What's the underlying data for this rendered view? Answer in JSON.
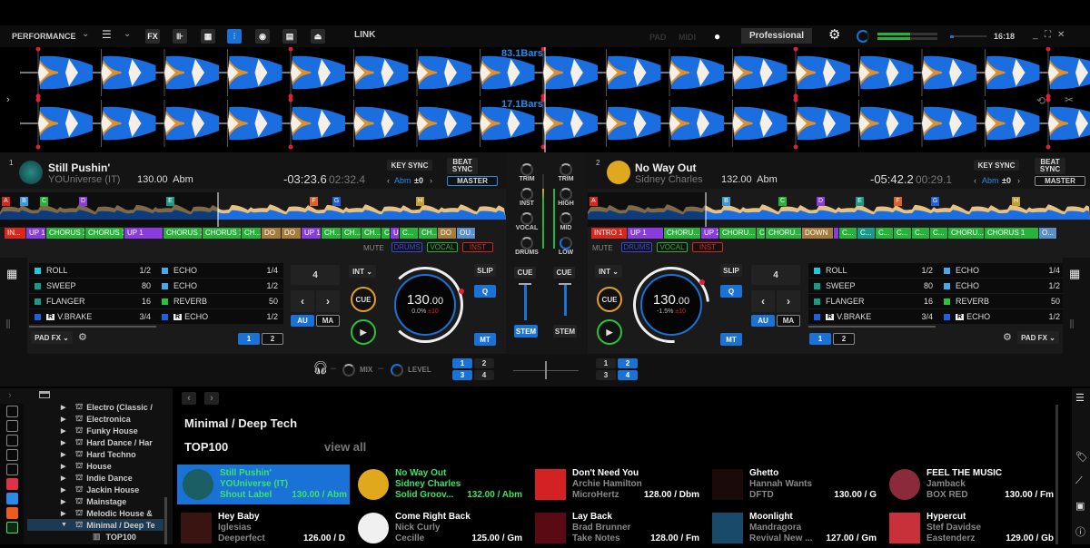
{
  "topbar": {
    "layout_label": "PERFORMANCE",
    "icons": [
      "fx-icon",
      "sampler-icon",
      "grid-icon",
      "mixer-icon",
      "record-icon",
      "video-icon",
      "webcam-icon"
    ],
    "link_label": "LINK",
    "pad_label": "PAD",
    "midi_label": "MIDI",
    "mode_label": "Professional",
    "time": "16:18"
  },
  "waveform": {
    "deck1_bars": "83.1Bars",
    "deck2_bars": "17.1Bars"
  },
  "deck1": {
    "number": "1",
    "title": "Still Pushin'",
    "artist": "YOUniverse (IT)",
    "bpm_key": "130.00  Abm",
    "remaining": "-03:23.6",
    "elapsed": "02:32.4",
    "key_sync": "KEY SYNC",
    "beat_sync": "BEAT SYNC",
    "key": "Abm",
    "key_offset": "±0",
    "master": "MASTER",
    "hotcues": [
      "A",
      "B",
      "C",
      "D",
      "E",
      "F",
      "G",
      "H"
    ],
    "segments": [
      {
        "label": "IN...",
        "color": "#d8281e",
        "w": 24
      },
      {
        "label": "UP 1",
        "color": "#8a3ce0",
        "w": 22
      },
      {
        "label": "CHORUS 1",
        "color": "#27b33a",
        "w": 43
      },
      {
        "label": "CHORUS 1",
        "color": "#27b33a",
        "w": 43
      },
      {
        "label": "UP 1",
        "color": "#8a3ce0",
        "w": 43
      },
      {
        "label": "CHORUS 1",
        "color": "#27b33a",
        "w": 43
      },
      {
        "label": "CHORUS 1",
        "color": "#27b33a",
        "w": 43
      },
      {
        "label": "CH...",
        "color": "#27b33a",
        "w": 22
      },
      {
        "label": "DO",
        "color": "#a67c3c",
        "w": 22
      },
      {
        "label": "DO",
        "color": "#a67c3c",
        "w": 22
      },
      {
        "label": "UP 1",
        "color": "#8a3ce0",
        "w": 22
      },
      {
        "label": "CH...",
        "color": "#27b33a",
        "w": 22
      },
      {
        "label": "CH...",
        "color": "#27b33a",
        "w": 22
      },
      {
        "label": "CH...",
        "color": "#27b33a",
        "w": 22
      },
      {
        "label": "C",
        "color": "#27b33a",
        "w": 10
      },
      {
        "label": "U",
        "color": "#8a3ce0",
        "w": 10
      },
      {
        "label": "C...",
        "color": "#27b33a",
        "w": 21
      },
      {
        "label": "CH...",
        "color": "#27b33a",
        "w": 21
      },
      {
        "label": "DO",
        "color": "#a67c3c",
        "w": 21
      },
      {
        "label": "OU...",
        "color": "#5b8fc9",
        "w": 21
      }
    ],
    "mute_label": "MUTE",
    "stems": [
      "DRUMS",
      "VOCAL",
      "INST"
    ],
    "pad_fx": [
      {
        "name": "ROLL",
        "val": "1/2",
        "color": "#1fc7e0",
        "r": false
      },
      {
        "name": "SWEEP",
        "val": "80",
        "color": "#1a9b8a",
        "r": false
      },
      {
        "name": "FLANGER",
        "val": "16",
        "color": "#1a9b8a",
        "r": false
      },
      {
        "name": "V.BRAKE",
        "val": "3/4",
        "color": "#2060e0",
        "r": true
      }
    ],
    "pad_fx2": [
      {
        "name": "ECHO",
        "val": "1/4",
        "color": "#4aa8e8",
        "r": false
      },
      {
        "name": "ECHO",
        "val": "1/2",
        "color": "#4aa8e8",
        "r": false
      },
      {
        "name": "REVERB",
        "val": "50",
        "color": "#28c43a",
        "r": false
      },
      {
        "name": "ECHO",
        "val": "1/2",
        "color": "#2060e0",
        "r": true
      }
    ],
    "pad_fx_label": "PAD FX",
    "pages": [
      "1",
      "2"
    ],
    "loop_beats": "4",
    "au": "AU",
    "ma": "MA",
    "int": "INT",
    "cue": "CUE",
    "jog_bpm": "130",
    "jog_bpm_dec": ".00",
    "pitch": "0.0%",
    "range": "±10",
    "slip": "SLIP",
    "q": "Q",
    "mt": "MT"
  },
  "deck2": {
    "number": "2",
    "title": "No Way Out",
    "artist": "Sidney Charles",
    "bpm_key": "132.00  Abm",
    "remaining": "-05:42.2",
    "elapsed": "00:29.1",
    "key_sync": "KEY SYNC",
    "beat_sync": "BEAT SYNC",
    "key": "Abm",
    "key_offset": "±0",
    "master": "MASTER",
    "hotcues": [
      "A",
      "B",
      "C",
      "D",
      "E",
      "F",
      "G",
      "H"
    ],
    "segments": [
      {
        "label": "INTRO 1",
        "color": "#d8281e",
        "w": 40
      },
      {
        "label": "UP 1",
        "color": "#8a3ce0",
        "w": 40
      },
      {
        "label": "CHORU...",
        "color": "#27b33a",
        "w": 41
      },
      {
        "label": "UP 2",
        "color": "#8a3ce0",
        "w": 20
      },
      {
        "label": "CHORU...",
        "color": "#27b33a",
        "w": 41
      },
      {
        "label": "C",
        "color": "#27b33a",
        "w": 10
      },
      {
        "label": "CHORU...",
        "color": "#27b33a",
        "w": 40
      },
      {
        "label": "DOWN",
        "color": "#a67c3c",
        "w": 35
      },
      {
        "label": "",
        "color": "#8a3ce0",
        "w": 6
      },
      {
        "label": "C...",
        "color": "#27b33a",
        "w": 20
      },
      {
        "label": "C...",
        "color": "#1a9b8a",
        "w": 20
      },
      {
        "label": "C...",
        "color": "#27b33a",
        "w": 20
      },
      {
        "label": "C...",
        "color": "#27b33a",
        "w": 20
      },
      {
        "label": "C...",
        "color": "#27b33a",
        "w": 20
      },
      {
        "label": "C...",
        "color": "#27b33a",
        "w": 20
      },
      {
        "label": "CHORU...",
        "color": "#27b33a",
        "w": 40
      },
      {
        "label": "CHORUS 1",
        "color": "#27b33a",
        "w": 60
      },
      {
        "label": "O...",
        "color": "#5b8fc9",
        "w": 20
      }
    ],
    "mute_label": "MUTE",
    "stems": [
      "DRUMS",
      "VOCAL",
      "INST"
    ],
    "pad_fx": [
      {
        "name": "ROLL",
        "val": "1/2",
        "color": "#1fc7e0",
        "r": false
      },
      {
        "name": "SWEEP",
        "val": "80",
        "color": "#1a9b8a",
        "r": false
      },
      {
        "name": "FLANGER",
        "val": "16",
        "color": "#1a9b8a",
        "r": false
      },
      {
        "name": "V.BRAKE",
        "val": "3/4",
        "color": "#2060e0",
        "r": true
      }
    ],
    "pad_fx2": [
      {
        "name": "ECHO",
        "val": "1/4",
        "color": "#4aa8e8",
        "r": false
      },
      {
        "name": "ECHO",
        "val": "1/2",
        "color": "#4aa8e8",
        "r": false
      },
      {
        "name": "REVERB",
        "val": "50",
        "color": "#28c43a",
        "r": false
      },
      {
        "name": "ECHO",
        "val": "1/2",
        "color": "#2060e0",
        "r": true
      }
    ],
    "pad_fx_label": "PAD FX",
    "pages": [
      "1",
      "2"
    ],
    "loop_beats": "4",
    "au": "AU",
    "ma": "MA",
    "int": "INT",
    "cue": "CUE",
    "jog_bpm": "130",
    "jog_bpm_dec": ".00",
    "pitch": "-1.5%",
    "range": "±10",
    "slip": "SLIP",
    "q": "Q",
    "mt": "MT"
  },
  "mixer": {
    "left_knobs": [
      "TRIM",
      "INST",
      "VOCAL",
      "DRUMS"
    ],
    "right_knobs": [
      "TRIM",
      "HIGH",
      "MID",
      "LOW"
    ],
    "cue": "CUE",
    "stem": "STEM",
    "mix_label": "MIX",
    "level_label": "LEVEL",
    "deck_sel_left": [
      "1",
      "2",
      "3",
      "4"
    ],
    "deck_sel_right": [
      "1",
      "2",
      "3",
      "4"
    ]
  },
  "browser": {
    "tree": [
      {
        "label": "Electro (Classic /",
        "expanded": false
      },
      {
        "label": "Electronica",
        "expanded": false
      },
      {
        "label": "Funky House",
        "expanded": false
      },
      {
        "label": "Hard Dance / Har",
        "expanded": false
      },
      {
        "label": "Hard Techno",
        "expanded": false
      },
      {
        "label": "House",
        "expanded": false
      },
      {
        "label": "Indie Dance",
        "expanded": false
      },
      {
        "label": "Jackin House",
        "expanded": false
      },
      {
        "label": "Mainstage",
        "expanded": false
      },
      {
        "label": "Melodic House &",
        "expanded": false
      },
      {
        "label": "Minimal / Deep Te",
        "expanded": true
      }
    ],
    "tree_child": "TOP100",
    "heading": "Minimal / Deep Tech",
    "section": "TOP100",
    "view_all": "view all",
    "tracks": [
      {
        "title": "Still Pushin'",
        "artist": "YOUniverse (IT)",
        "label": "Shout Label",
        "bpm_key": "130.00 / Abm",
        "art": "#1b5e63",
        "state": "sel"
      },
      {
        "title": "No Way Out",
        "artist": "Sidney Charles",
        "label": "Solid Groov...",
        "bpm_key": "132.00 / Abm",
        "art": "#e0a81c",
        "state": "loaded"
      },
      {
        "title": "Don't Need You",
        "artist": "Archie Hamilton",
        "label": "MicroHertz",
        "bpm_key": "128.00 / Dbm",
        "art": "#d42222",
        "state": ""
      },
      {
        "title": "Ghetto",
        "artist": "Hannah Wants",
        "label": "DFTD",
        "bpm_key": "130.00 / G",
        "art": "#1a0a0a",
        "state": ""
      },
      {
        "title": "FEEL THE MUSIC",
        "artist": "Jamback",
        "label": "BOX RED",
        "bpm_key": "130.00 / Fm",
        "art": "#8a2a3a",
        "state": ""
      },
      {
        "title": "Hey Baby",
        "artist": "Iglesias",
        "label": "Deeperfect",
        "bpm_key": "126.00 / D",
        "art": "#3a1410",
        "state": ""
      },
      {
        "title": "Come Right Back",
        "artist": "Nick Curly",
        "label": "Cecille",
        "bpm_key": "125.00 / Gm",
        "art": "#f0f0f0",
        "state": ""
      },
      {
        "title": "Lay Back",
        "artist": "Brad Brunner",
        "label": "Take Notes",
        "bpm_key": "128.00 / Fm",
        "art": "#5a0a12",
        "state": ""
      },
      {
        "title": "Moonlight",
        "artist": "Mandragora",
        "label": "Revival New ...",
        "bpm_key": "127.00 / Gm",
        "art": "#1a4a6a",
        "state": ""
      },
      {
        "title": "Hypercut",
        "artist": "Stef Davidse",
        "label": "Eastenderz",
        "bpm_key": "129.00 / Gb",
        "art": "#c8303a",
        "state": ""
      }
    ]
  },
  "colors": {
    "accent": "#1a72d6",
    "loaded": "#3ce36a",
    "wave_blue": "#1a6ee0",
    "wave_orange": "#e0902a"
  }
}
